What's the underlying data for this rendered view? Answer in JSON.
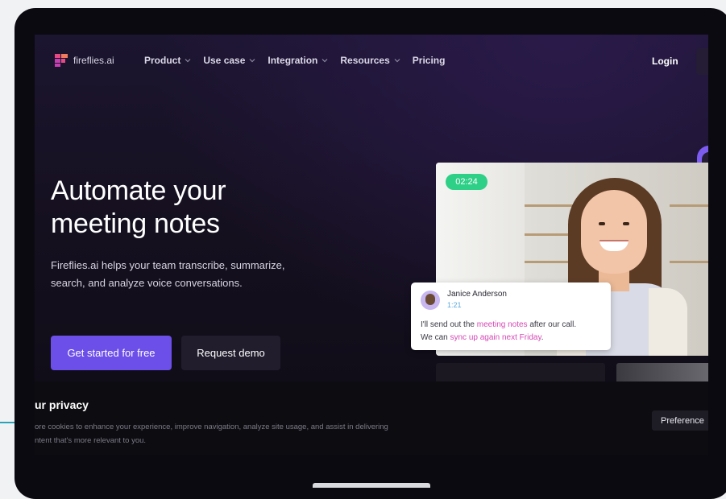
{
  "brand": {
    "name": "fireflies.ai",
    "logo_colors": [
      "#e64a85",
      "#f07a5d",
      "#c63fb0"
    ]
  },
  "nav": {
    "items": [
      {
        "label": "Product",
        "has_dropdown": true
      },
      {
        "label": "Use case",
        "has_dropdown": true
      },
      {
        "label": "Integration",
        "has_dropdown": true
      },
      {
        "label": "Resources",
        "has_dropdown": true
      },
      {
        "label": "Pricing",
        "has_dropdown": false
      }
    ],
    "login": "Login"
  },
  "hero": {
    "title_lines": [
      "Automate your",
      "meeting notes"
    ],
    "subtitle_lines": [
      "Fireflies.ai helps your team transcribe, summarize,",
      "search, and analyze voice conversations."
    ],
    "primary_cta": "Get started for free",
    "secondary_cta": "Request demo"
  },
  "video": {
    "timer": "02:24",
    "chat": {
      "name": "Janice Anderson",
      "time": "1:21",
      "line1_pre": "I'll send out the ",
      "line1_hl": "meeting notes",
      "line1_post": " after our call.",
      "line2_pre": "We can ",
      "line2_hl": "sync up again next Friday",
      "line2_post": "."
    }
  },
  "privacy": {
    "title": "ur privacy",
    "text_lines": [
      "ore cookies to enhance your experience, improve navigation, analyze site usage, and assist in delivering",
      "ntent that's more relevant to you."
    ],
    "preferences_button": "Preference"
  },
  "colors": {
    "primary": "#6c4ee8",
    "timer": "#2ecf86",
    "highlight": "#d548b6",
    "accent_line": "#2aa3b8"
  }
}
